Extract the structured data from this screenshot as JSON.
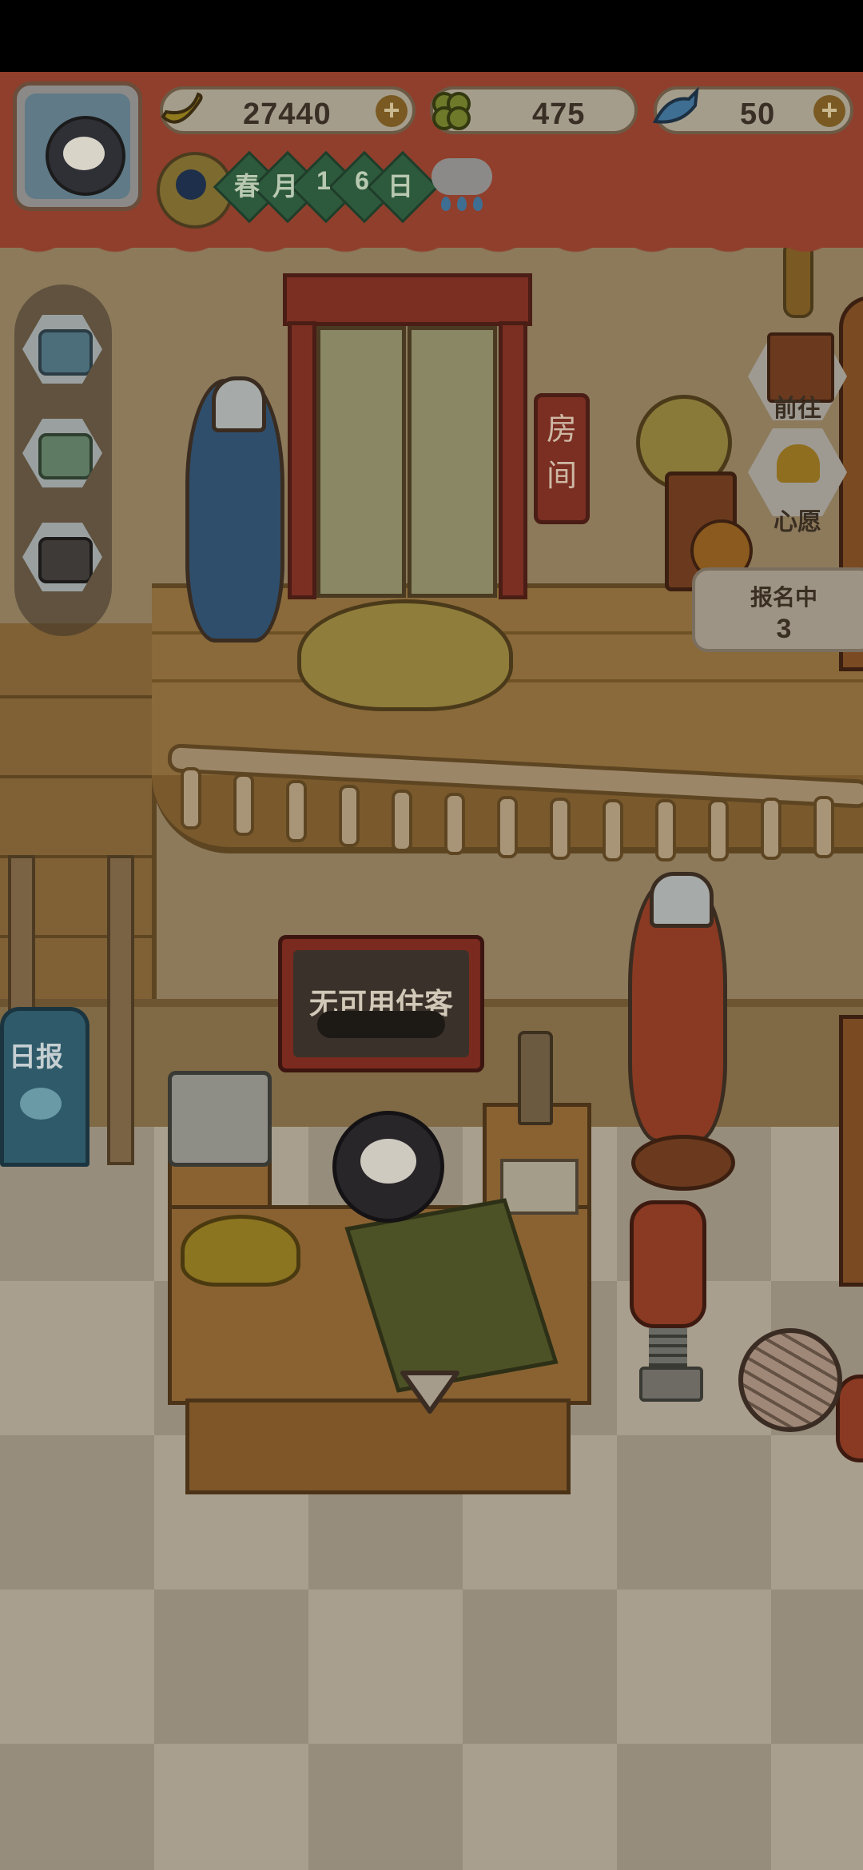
{
  "currencies": {
    "banana": {
      "value": "27440",
      "icon": "banana-icon"
    },
    "clover": {
      "value": "475",
      "icon": "clover-icon"
    },
    "fish": {
      "value": "50",
      "icon": "fish-icon"
    }
  },
  "date": {
    "chars": [
      "春",
      "月",
      "1",
      "6",
      "日"
    ],
    "weather_icon": "rain-cloud-icon"
  },
  "sidebar": {
    "items": [
      "tv-video-icon",
      "shop-stall-icon",
      "camera-icon"
    ]
  },
  "elevator": {
    "sign": "房间"
  },
  "right_buttons": {
    "go": {
      "label": "前往"
    },
    "wish": {
      "label": "心愿"
    }
  },
  "signup": {
    "label": "报名中",
    "count": "3"
  },
  "reception": {
    "sign_text": "无可用住客"
  },
  "newsboard": {
    "label": "日报"
  },
  "colors": {
    "banner": "#8f3f2c",
    "wall": "#8c7a5b",
    "wood": "#8a6232"
  }
}
